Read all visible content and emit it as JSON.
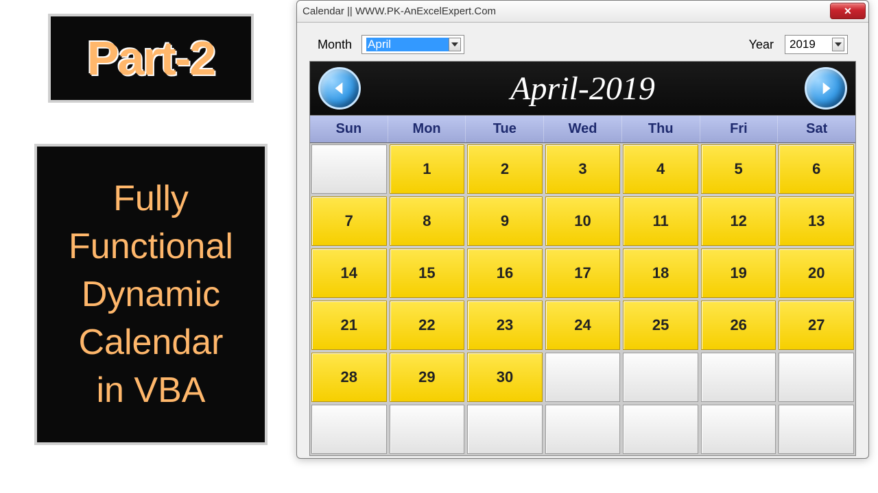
{
  "title_card": "Part-2",
  "desc_lines": [
    "Fully",
    "Functional",
    "Dynamic",
    "Calendar",
    "in VBA"
  ],
  "window": {
    "title": "Calendar || WWW.PK-AnExcelExpert.Com",
    "month_label": "Month",
    "year_label": "Year",
    "month_value": "April",
    "year_value": "2019",
    "header_title": "April-2019",
    "dow": [
      "Sun",
      "Mon",
      "Tue",
      "Wed",
      "Thu",
      "Fri",
      "Sat"
    ],
    "weeks": [
      [
        "",
        "1",
        "2",
        "3",
        "4",
        "5",
        "6"
      ],
      [
        "7",
        "8",
        "9",
        "10",
        "11",
        "12",
        "13"
      ],
      [
        "14",
        "15",
        "16",
        "17",
        "18",
        "19",
        "20"
      ],
      [
        "21",
        "22",
        "23",
        "24",
        "25",
        "26",
        "27"
      ],
      [
        "28",
        "29",
        "30",
        "",
        "",
        "",
        ""
      ],
      [
        "",
        "",
        "",
        "",
        "",
        "",
        ""
      ]
    ]
  }
}
